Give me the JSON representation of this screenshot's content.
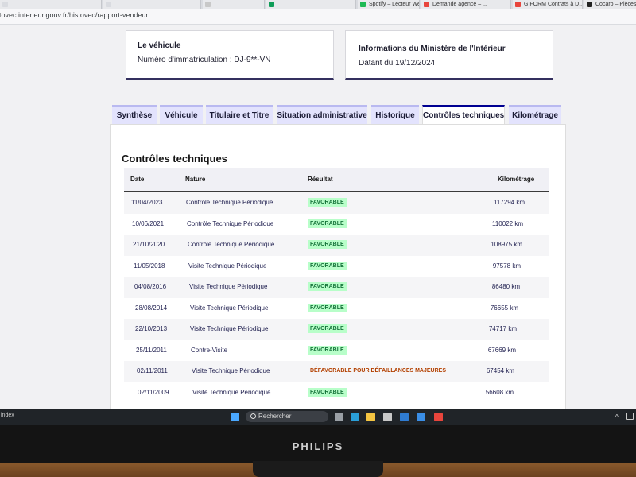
{
  "browser": {
    "tabs": [
      {
        "label": "",
        "color": "#d9dbe0"
      },
      {
        "label": "",
        "color": "#d9dbe0"
      },
      {
        "label": "",
        "color": "#c8c8c8"
      },
      {
        "label": "",
        "color": "#0f9d58"
      },
      {
        "label": "Spotify – Lecteur Web",
        "color": "#1db954"
      },
      {
        "label": "Demande agence – ...",
        "color": "#e8453c"
      },
      {
        "label": "G FORM Contrats à D...",
        "color": "#e8453c"
      },
      {
        "label": "Cocaro – Pièces au ...",
        "color": "#222222"
      }
    ],
    "url": "tovec.interieur.gouv.fr/histovec/rapport-vendeur"
  },
  "vehicle_card": {
    "heading": "Le véhicule",
    "registration": "Numéro d'immatriculation : DJ-9**-VN"
  },
  "ministry_card": {
    "heading": "Informations du Ministère de l'Intérieur",
    "date": "Datant du 19/12/2024"
  },
  "tabs": [
    {
      "label": "Synthèse",
      "active": false
    },
    {
      "label": "Véhicule",
      "active": false
    },
    {
      "label": "Titulaire et Titre",
      "active": false
    },
    {
      "label": "Situation administrative",
      "active": false
    },
    {
      "label": "Historique",
      "active": false
    },
    {
      "label": "Contrôles techniques",
      "active": true
    },
    {
      "label": "Kilométrage",
      "active": false
    }
  ],
  "section_title": "Contrôles techniques",
  "table": {
    "headers": {
      "date": "Date",
      "nature": "Nature",
      "result": "Résultat",
      "mileage": "Kilométrage"
    },
    "rows": [
      {
        "date": "11/04/2023",
        "nature": "Contrôle Technique Périodique",
        "result": "FAVORABLE",
        "status": "ok",
        "km": "117294 km"
      },
      {
        "date": "10/06/2021",
        "nature": "Contrôle Technique Périodique",
        "result": "FAVORABLE",
        "status": "ok",
        "km": "110022 km"
      },
      {
        "date": "21/10/2020",
        "nature": "Contrôle Technique Périodique",
        "result": "FAVORABLE",
        "status": "ok",
        "km": "108975 km"
      },
      {
        "date": "11/05/2018",
        "nature": "Visite Technique Périodique",
        "result": "FAVORABLE",
        "status": "ok",
        "km": "97578 km"
      },
      {
        "date": "04/08/2016",
        "nature": "Visite Technique Périodique",
        "result": "FAVORABLE",
        "status": "ok",
        "km": "86480 km"
      },
      {
        "date": "28/08/2014",
        "nature": "Visite Technique Périodique",
        "result": "FAVORABLE",
        "status": "ok",
        "km": "76655 km"
      },
      {
        "date": "22/10/2013",
        "nature": "Visite Technique Périodique",
        "result": "FAVORABLE",
        "status": "ok",
        "km": "74717 km"
      },
      {
        "date": "25/11/2011",
        "nature": "Contre-Visite",
        "result": "FAVORABLE",
        "status": "ok",
        "km": "67669 km"
      },
      {
        "date": "02/11/2011",
        "nature": "Visite Technique Périodique",
        "result": "DÉFAVORABLE POUR DÉFAILLANCES MAJEURES",
        "status": "ko",
        "km": "67454 km"
      },
      {
        "date": "02/11/2009",
        "nature": "Visite Technique Périodique",
        "result": "FAVORABLE",
        "status": "ok",
        "km": "56608 km"
      }
    ]
  },
  "taskbar": {
    "left_text": "index",
    "search_placeholder": "Rechercher",
    "tray_chevron": "^",
    "icons": [
      {
        "name": "task-view-icon",
        "color": "#9aa0a6"
      },
      {
        "name": "edge-icon",
        "color": "#2a9fd8"
      },
      {
        "name": "file-explorer-icon",
        "color": "#f4c542"
      },
      {
        "name": "store-icon",
        "color": "#c8c8c8"
      },
      {
        "name": "outlook-icon",
        "color": "#2f7cd3"
      },
      {
        "name": "photos-icon",
        "color": "#3a8ee6"
      },
      {
        "name": "chrome-icon",
        "color": "#e8453c"
      }
    ]
  },
  "monitor": {
    "brand": "PHILIPS"
  }
}
